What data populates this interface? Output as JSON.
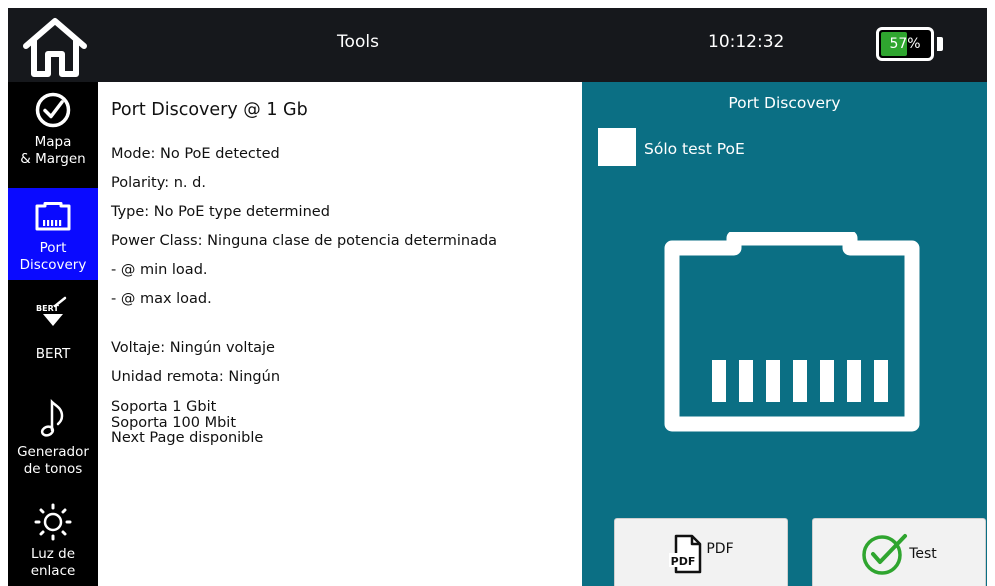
{
  "topbar": {
    "title": "Tools",
    "time": "10:12:32",
    "battery": {
      "label": "57%",
      "level": 0.57,
      "color": "#2fa52f"
    }
  },
  "sidebar": {
    "items": [
      {
        "label": "Mapa\n& Margen",
        "icon": "checkmark-circle-icon",
        "active": false
      },
      {
        "label": "Port\nDiscovery",
        "icon": "ethernet-port-icon",
        "active": true
      },
      {
        "label": "BERT",
        "icon": "bert-icon",
        "icon_text": "BERT",
        "active": false
      },
      {
        "label": "Generador\nde tonos",
        "icon": "music-note-icon",
        "active": false
      },
      {
        "label": "Luz de\nenlace",
        "icon": "sun-icon",
        "active": false
      }
    ],
    "active_color": "#0a0aff"
  },
  "content": {
    "title": "Port Discovery @ 1 Gb",
    "lines": [
      "Mode: No PoE detected",
      "Polarity: n. d.",
      "Type: No PoE type determined",
      "Power Class: Ninguna clase de potencia determinada",
      "- @ min load.",
      "- @ max load.",
      "Voltaje: Ningún voltaje",
      "Unidad remota: Ningún"
    ],
    "support": [
      "Soporta 1 Gbit",
      "Soporta 100 Mbit",
      "Next Page disponible"
    ]
  },
  "panel": {
    "title": "Port Discovery",
    "checkbox_label": "Sólo test PoE",
    "checkbox_checked": false,
    "background": "#0b6f84",
    "pdf_icon_text": "PDF",
    "pdf_label": "PDF",
    "test_label": "Test",
    "test_icon_color": "#2fa52f"
  }
}
